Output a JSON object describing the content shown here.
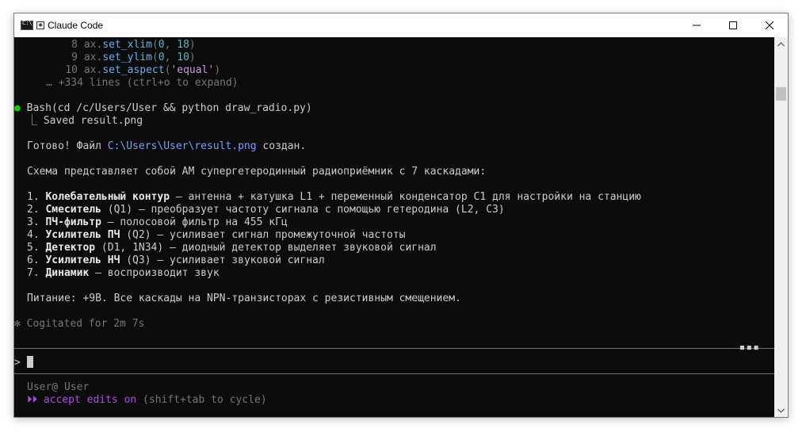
{
  "window": {
    "title": "Claude Code",
    "controls": {
      "minimize": "—",
      "maximize": "☐",
      "close": "✕"
    }
  },
  "code_preview": [
    {
      "num": "8",
      "obj": "ax.",
      "fn": "set_xlim",
      "open": "(",
      "args": [
        {
          "t": "num",
          "v": "0"
        },
        {
          "t": "plain",
          "v": ", "
        },
        {
          "t": "num",
          "v": "18"
        }
      ],
      "close": ")"
    },
    {
      "num": "9",
      "obj": "ax.",
      "fn": "set_ylim",
      "open": "(",
      "args": [
        {
          "t": "num",
          "v": "0"
        },
        {
          "t": "plain",
          "v": ", "
        },
        {
          "t": "num",
          "v": "10"
        }
      ],
      "close": ")"
    },
    {
      "num": "10",
      "obj": "ax.",
      "fn": "set_aspect",
      "open": "(",
      "args": [
        {
          "t": "str",
          "v": "'equal'"
        }
      ],
      "close": ")"
    }
  ],
  "expand_hint": "… +334 lines (ctrl+o to expand)",
  "bash_call": {
    "bullet": "●",
    "command": "Bash(cd /c/Users/User && python draw_radio.py)",
    "result_prefix": "⎿",
    "result": " Saved result.png"
  },
  "answer": {
    "prefix": "Готово! Файл ",
    "path": "C:\\Users\\User\\result.png",
    "suffix": " создан."
  },
  "intro": "Схема представляет собой AM супергетеродинный радиоприёмник с 7 каскадами:",
  "stages": [
    {
      "num": "1.",
      "name": "Колебательный контур",
      "desc": " — антенна + катушка L1 + переменный конденсатор C1 для настройки на станцию"
    },
    {
      "num": "2.",
      "name": "Смеситель",
      "desc": " (Q1) — преобразует частоту сигнала с помощью гетеродина (L2, C3)"
    },
    {
      "num": "3.",
      "name": "ПЧ-фильтр",
      "desc": " — полосовой фильтр на 455 кГц"
    },
    {
      "num": "4.",
      "name": "Усилитель ПЧ",
      "desc": " (Q2) — усиливает сигнал промежуточной частоты"
    },
    {
      "num": "5.",
      "name": "Детектор",
      "desc": " (D1, 1N34) — диодный детектор выделяет звуковой сигнал"
    },
    {
      "num": "6.",
      "name": "Усилитель НЧ",
      "desc": " (Q3) — усиливает звуковой сигнал"
    },
    {
      "num": "7.",
      "name": "Динамик",
      "desc": " — воспроизводит звук"
    }
  ],
  "power_note": "Питание: +9В. Все каскады на NPN-транзисторах с резистивным смещением.",
  "status": {
    "icon": "✻",
    "text": "Cogitated for 2m 7s"
  },
  "prompt": {
    "symbol": ">",
    "value": ""
  },
  "footer": {
    "user": "User@ User",
    "mode_icon": "⏵⏵",
    "mode_text": "accept edits on",
    "mode_hint": " (shift+tab to cycle)"
  },
  "colors": {
    "background": "#0c0c0c",
    "text": "#cccccc",
    "bullet_green": "#16c60c",
    "accept_purple": "#b148e8",
    "path_blue": "#7e9cff"
  }
}
